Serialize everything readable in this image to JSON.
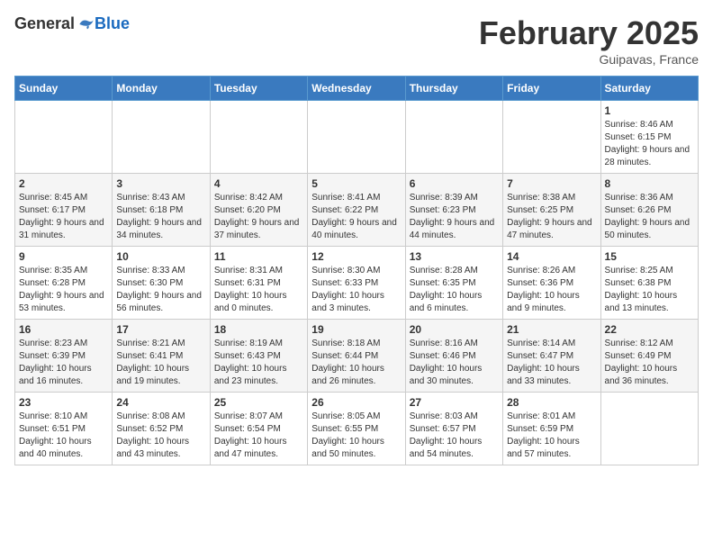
{
  "header": {
    "logo_general": "General",
    "logo_blue": "Blue",
    "month_title": "February 2025",
    "location": "Guipavas, France"
  },
  "calendar": {
    "days_of_week": [
      "Sunday",
      "Monday",
      "Tuesday",
      "Wednesday",
      "Thursday",
      "Friday",
      "Saturday"
    ],
    "weeks": [
      [
        {
          "day": "",
          "info": ""
        },
        {
          "day": "",
          "info": ""
        },
        {
          "day": "",
          "info": ""
        },
        {
          "day": "",
          "info": ""
        },
        {
          "day": "",
          "info": ""
        },
        {
          "day": "",
          "info": ""
        },
        {
          "day": "1",
          "info": "Sunrise: 8:46 AM\nSunset: 6:15 PM\nDaylight: 9 hours and 28 minutes."
        }
      ],
      [
        {
          "day": "2",
          "info": "Sunrise: 8:45 AM\nSunset: 6:17 PM\nDaylight: 9 hours and 31 minutes."
        },
        {
          "day": "3",
          "info": "Sunrise: 8:43 AM\nSunset: 6:18 PM\nDaylight: 9 hours and 34 minutes."
        },
        {
          "day": "4",
          "info": "Sunrise: 8:42 AM\nSunset: 6:20 PM\nDaylight: 9 hours and 37 minutes."
        },
        {
          "day": "5",
          "info": "Sunrise: 8:41 AM\nSunset: 6:22 PM\nDaylight: 9 hours and 40 minutes."
        },
        {
          "day": "6",
          "info": "Sunrise: 8:39 AM\nSunset: 6:23 PM\nDaylight: 9 hours and 44 minutes."
        },
        {
          "day": "7",
          "info": "Sunrise: 8:38 AM\nSunset: 6:25 PM\nDaylight: 9 hours and 47 minutes."
        },
        {
          "day": "8",
          "info": "Sunrise: 8:36 AM\nSunset: 6:26 PM\nDaylight: 9 hours and 50 minutes."
        }
      ],
      [
        {
          "day": "9",
          "info": "Sunrise: 8:35 AM\nSunset: 6:28 PM\nDaylight: 9 hours and 53 minutes."
        },
        {
          "day": "10",
          "info": "Sunrise: 8:33 AM\nSunset: 6:30 PM\nDaylight: 9 hours and 56 minutes."
        },
        {
          "day": "11",
          "info": "Sunrise: 8:31 AM\nSunset: 6:31 PM\nDaylight: 10 hours and 0 minutes."
        },
        {
          "day": "12",
          "info": "Sunrise: 8:30 AM\nSunset: 6:33 PM\nDaylight: 10 hours and 3 minutes."
        },
        {
          "day": "13",
          "info": "Sunrise: 8:28 AM\nSunset: 6:35 PM\nDaylight: 10 hours and 6 minutes."
        },
        {
          "day": "14",
          "info": "Sunrise: 8:26 AM\nSunset: 6:36 PM\nDaylight: 10 hours and 9 minutes."
        },
        {
          "day": "15",
          "info": "Sunrise: 8:25 AM\nSunset: 6:38 PM\nDaylight: 10 hours and 13 minutes."
        }
      ],
      [
        {
          "day": "16",
          "info": "Sunrise: 8:23 AM\nSunset: 6:39 PM\nDaylight: 10 hours and 16 minutes."
        },
        {
          "day": "17",
          "info": "Sunrise: 8:21 AM\nSunset: 6:41 PM\nDaylight: 10 hours and 19 minutes."
        },
        {
          "day": "18",
          "info": "Sunrise: 8:19 AM\nSunset: 6:43 PM\nDaylight: 10 hours and 23 minutes."
        },
        {
          "day": "19",
          "info": "Sunrise: 8:18 AM\nSunset: 6:44 PM\nDaylight: 10 hours and 26 minutes."
        },
        {
          "day": "20",
          "info": "Sunrise: 8:16 AM\nSunset: 6:46 PM\nDaylight: 10 hours and 30 minutes."
        },
        {
          "day": "21",
          "info": "Sunrise: 8:14 AM\nSunset: 6:47 PM\nDaylight: 10 hours and 33 minutes."
        },
        {
          "day": "22",
          "info": "Sunrise: 8:12 AM\nSunset: 6:49 PM\nDaylight: 10 hours and 36 minutes."
        }
      ],
      [
        {
          "day": "23",
          "info": "Sunrise: 8:10 AM\nSunset: 6:51 PM\nDaylight: 10 hours and 40 minutes."
        },
        {
          "day": "24",
          "info": "Sunrise: 8:08 AM\nSunset: 6:52 PM\nDaylight: 10 hours and 43 minutes."
        },
        {
          "day": "25",
          "info": "Sunrise: 8:07 AM\nSunset: 6:54 PM\nDaylight: 10 hours and 47 minutes."
        },
        {
          "day": "26",
          "info": "Sunrise: 8:05 AM\nSunset: 6:55 PM\nDaylight: 10 hours and 50 minutes."
        },
        {
          "day": "27",
          "info": "Sunrise: 8:03 AM\nSunset: 6:57 PM\nDaylight: 10 hours and 54 minutes."
        },
        {
          "day": "28",
          "info": "Sunrise: 8:01 AM\nSunset: 6:59 PM\nDaylight: 10 hours and 57 minutes."
        },
        {
          "day": "",
          "info": ""
        }
      ]
    ]
  }
}
